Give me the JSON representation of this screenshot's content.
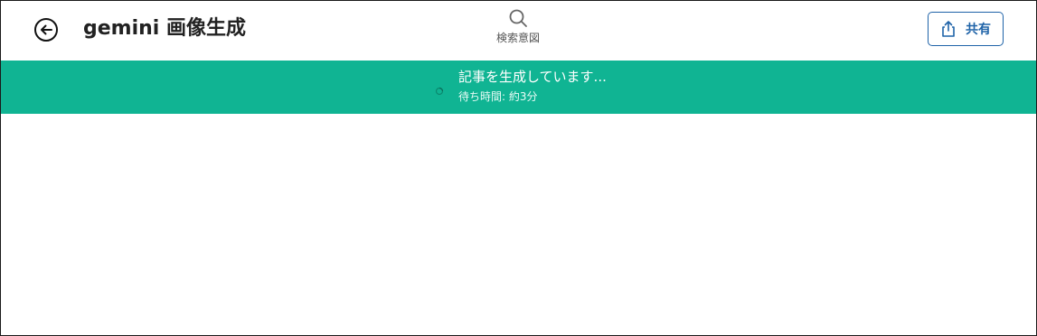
{
  "header": {
    "title": "gemini 画像生成",
    "back_icon": "arrow-left-circle-icon",
    "search_intent": {
      "icon": "search-icon",
      "label": "検索意図"
    },
    "share": {
      "icon": "share-icon",
      "label": "共有"
    }
  },
  "banner": {
    "title": "記事を生成しています...",
    "subtitle": "待ち時間: 約3分",
    "icon": "spinner-icon"
  },
  "colors": {
    "banner_bg": "#10b493",
    "accent_blue": "#1f63a8",
    "text_dark": "#222222"
  }
}
